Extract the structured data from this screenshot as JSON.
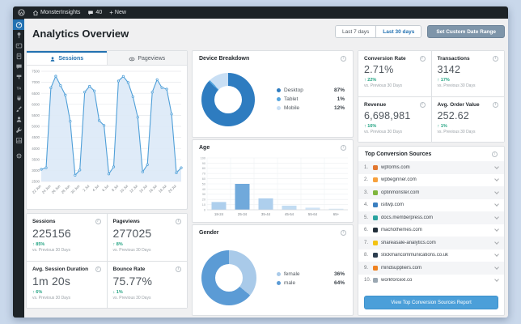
{
  "admin_bar": {
    "site_name": "MonsterInsights",
    "comments_count": "40",
    "new_label": "New"
  },
  "sidebar": {
    "items": [
      {
        "icon": "dashboard",
        "active": true
      },
      {
        "icon": "posts"
      },
      {
        "icon": "media"
      },
      {
        "icon": "pages"
      },
      {
        "icon": "comments"
      },
      {
        "icon": "appearance"
      },
      {
        "icon": "typography"
      },
      {
        "icon": "plugins"
      },
      {
        "icon": "customizer"
      },
      {
        "icon": "users"
      },
      {
        "icon": "tools"
      },
      {
        "icon": "insights"
      },
      {
        "icon": "settings"
      }
    ]
  },
  "header": {
    "title": "Analytics Overview",
    "date_buttons": [
      "Last 7 days",
      "Last 30 days"
    ],
    "active_date": "Last 30 days",
    "custom_button": "Set Custom Date Range"
  },
  "tabs": [
    {
      "label": "Sessions",
      "icon": "person-icon",
      "active": true
    },
    {
      "label": "Pageviews",
      "icon": "eye-icon",
      "active": false
    }
  ],
  "chart_data": [
    {
      "type": "line",
      "title": "Sessions",
      "x": [
        "22 Jun",
        "23 Jun",
        "24 Jun",
        "25 Jun",
        "26 Jun",
        "27 Jun",
        "28 Jun",
        "29 Jun",
        "30 Jun",
        "1 Jul",
        "2 Jul",
        "3 Jul",
        "4 Jul",
        "5 Jul",
        "6 Jul",
        "7 Jul",
        "8 Jul",
        "9 Jul",
        "10 Jul",
        "11 Jul",
        "12 Jul",
        "13 Jul",
        "14 Jul",
        "15 Jul",
        "16 Jul",
        "17 Jul",
        "18 Jul",
        "19 Jul",
        "20 Jul",
        "21 Jul"
      ],
      "x_tick_labels": [
        "22 Jun",
        "24 Jun",
        "26 Jun",
        "28 Jun",
        "30 Jun",
        "2 Jul",
        "4 Jul",
        "6 Jul",
        "8 Jul",
        "10 Jul",
        "12 Jul",
        "14 Jul",
        "16 Jul",
        "18 Jul",
        "20 Jul"
      ],
      "values": [
        3050,
        3120,
        6750,
        7280,
        6850,
        6420,
        5230,
        2780,
        3020,
        6560,
        6820,
        6610,
        5260,
        5040,
        2840,
        3160,
        7060,
        7270,
        6990,
        6350,
        5410,
        2930,
        3260,
        6550,
        7120,
        6760,
        6690,
        5560,
        2890,
        3120
      ],
      "ylim": [
        2500,
        7500
      ],
      "ytick_step": 500,
      "grid": true,
      "line_color": "#4f9fd8",
      "fill_color": "#dbe9f7"
    },
    {
      "type": "pie",
      "donut": true,
      "title": "Device Breakdown",
      "labels": [
        "Desktop",
        "Tablet",
        "Mobile"
      ],
      "values": [
        87,
        1,
        12
      ],
      "value_labels": [
        "87%",
        "1%",
        "12%"
      ],
      "colors": [
        "#2e7cc0",
        "#54a4dd",
        "#c9dff4"
      ],
      "legend_position": "right"
    },
    {
      "type": "bar",
      "title": "Age",
      "categories": [
        "18-24",
        "25-34",
        "35-44",
        "45-54",
        "55-64",
        "65+"
      ],
      "values": [
        15,
        50,
        22,
        8,
        4,
        2
      ],
      "colors": [
        "#aecfed",
        "#70a9db",
        "#aecfed",
        "#c2dcf2",
        "#cfe3f5",
        "#d8e9f7"
      ],
      "ylim": [
        0,
        100
      ],
      "ytick_step": 10,
      "grid": true,
      "xlabel": "",
      "ylabel": ""
    },
    {
      "type": "pie",
      "donut": true,
      "title": "Gender",
      "labels": [
        "female",
        "male"
      ],
      "values": [
        36,
        64
      ],
      "value_labels": [
        "36%",
        "64%"
      ],
      "colors": [
        "#a9cae9",
        "#5b9bd5"
      ],
      "legend_position": "right"
    }
  ],
  "stat_cards_left": [
    {
      "title": "Sessions",
      "value": "225156",
      "delta": "85%",
      "direction": "up",
      "compare": "vs. Previous 30 Days"
    },
    {
      "title": "Pageviews",
      "value": "277025",
      "delta": "8%",
      "direction": "up",
      "compare": "vs. Previous 30 Days"
    },
    {
      "title": "Avg. Session Duration",
      "value": "1m 20s",
      "delta": "6%",
      "direction": "up",
      "compare": "vs. Previous 30 Days"
    },
    {
      "title": "Bounce Rate",
      "value": "75.77%",
      "delta": "1%",
      "direction": "down",
      "compare": "vs. Previous 30 Days"
    }
  ],
  "stat_cards_right": [
    {
      "title": "Conversion Rate",
      "value": "2.71%",
      "delta": "22%",
      "direction": "up",
      "compare": "vs. Previous 30 Days"
    },
    {
      "title": "Transactions",
      "value": "3142",
      "delta": "17%",
      "direction": "up",
      "compare": "vs. Previous 30 Days"
    },
    {
      "title": "Revenue",
      "value": "6,698,981",
      "delta": "16%",
      "direction": "up",
      "compare": "vs. Previous 30 Days"
    },
    {
      "title": "Avg. Order Value",
      "value": "252.62",
      "delta": "1%",
      "direction": "up",
      "compare": "vs. Previous 30 Days"
    }
  ],
  "sources": {
    "title": "Top Conversion Sources",
    "items": [
      {
        "rank": "1.",
        "domain": "wpforms.com",
        "color": "#e27730"
      },
      {
        "rank": "2.",
        "domain": "wpbeginner.com",
        "color": "#f7a13d"
      },
      {
        "rank": "3.",
        "domain": "optinmonster.com",
        "color": "#7fb63d"
      },
      {
        "rank": "4.",
        "domain": "isitwp.com",
        "color": "#3a7fc0"
      },
      {
        "rank": "5.",
        "domain": "docs.memberpress.com",
        "color": "#29a39f"
      },
      {
        "rank": "6.",
        "domain": "machothemes.com",
        "color": "#222f3a"
      },
      {
        "rank": "7.",
        "domain": "shareasale-analytics.com",
        "color": "#f3c313"
      },
      {
        "rank": "8.",
        "domain": "stickmancommunications.co.uk",
        "color": "#2d3e50"
      },
      {
        "rank": "9.",
        "domain": "mindsuppliers.com",
        "color": "#ef8221"
      },
      {
        "rank": "10.",
        "domain": "workforcexl.co",
        "color": "#9aa7b2"
      }
    ],
    "button": "View Top Conversion Sources Report"
  },
  "colors": {
    "positive": "#23a382",
    "accent": "#2271b1",
    "chart_blue": "#4f9fd8"
  }
}
